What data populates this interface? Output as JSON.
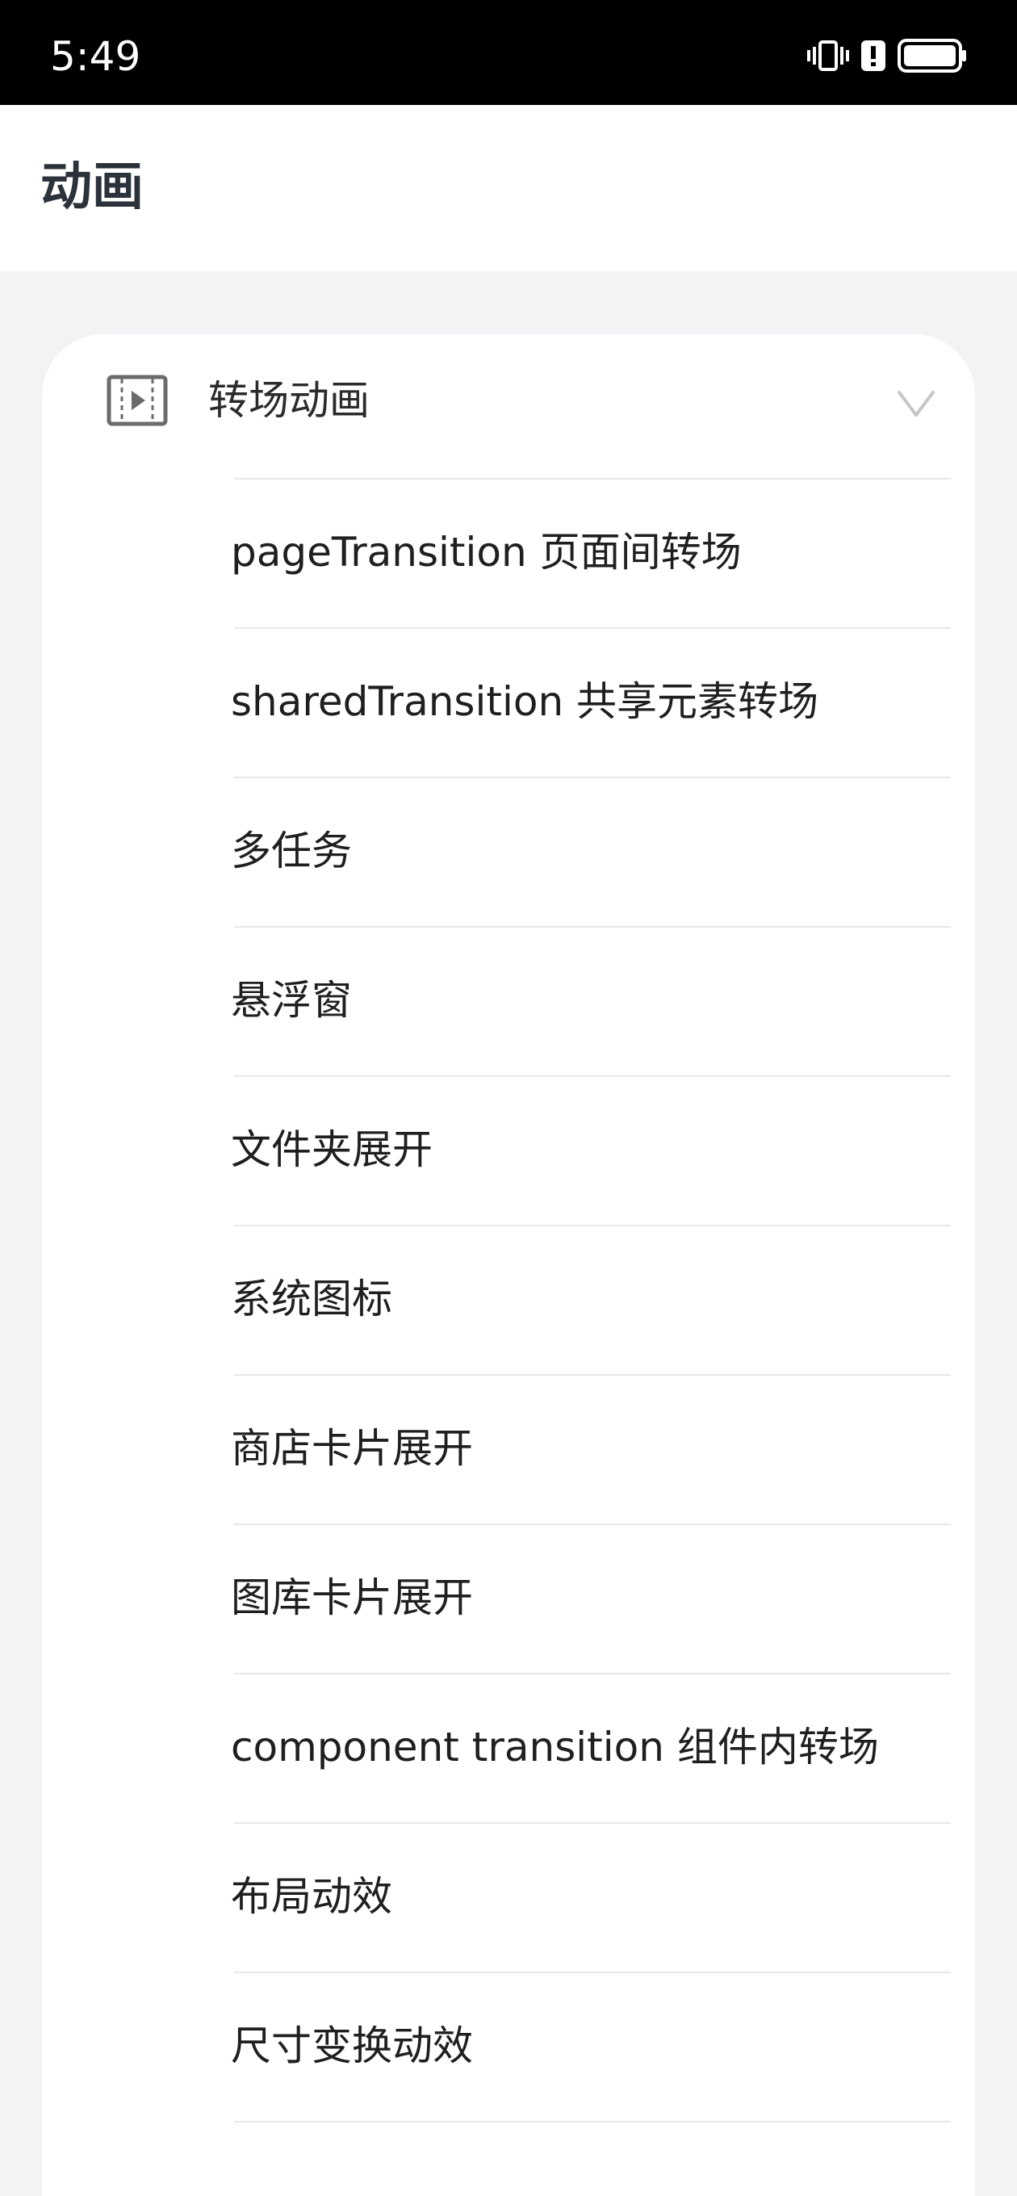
{
  "status_bar": {
    "time": "5:49",
    "icons": [
      "vibrate-icon",
      "alert-icon",
      "battery-icon"
    ]
  },
  "header": {
    "title": "动画"
  },
  "group": {
    "icon": "video-icon",
    "label": "转场动画",
    "expanded": true,
    "items": [
      {
        "label": "pageTransition 页面间转场"
      },
      {
        "label": "sharedTransition 共享元素转场"
      },
      {
        "label": "多任务"
      },
      {
        "label": "悬浮窗"
      },
      {
        "label": "文件夹展开"
      },
      {
        "label": "系统图标"
      },
      {
        "label": "商店卡片展开"
      },
      {
        "label": "图库卡片展开"
      },
      {
        "label": "component transition 组件内转场"
      },
      {
        "label": "布局动效"
      },
      {
        "label": "尺寸变换动效"
      }
    ]
  }
}
